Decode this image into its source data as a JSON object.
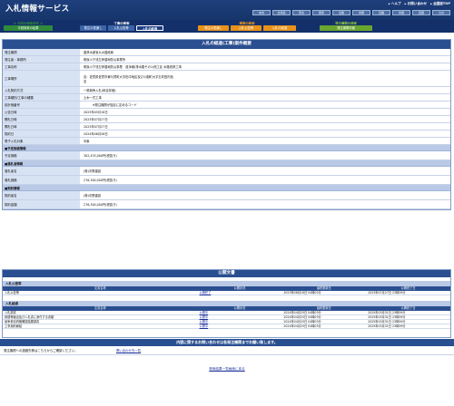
{
  "app": {
    "title": "入札情報サービス",
    "top_links": [
      "ヘルプ",
      "お問い合わせ",
      "全国版TOP"
    ],
    "regions": [
      "本省",
      "北海道",
      "東北",
      "関東",
      "北陸",
      "中部",
      "近畿",
      "中国",
      "四国",
      "九州"
    ]
  },
  "nav": {
    "groups": [
      {
        "title": "＊ 今回の検索条件 ＊",
        "color": "#2f8a3a",
        "tabs": [
          {
            "label": "今回検索の結果",
            "bg": "#2f8a3a"
          }
        ]
      },
      {
        "title": "工事の検索",
        "color": "#ffffff",
        "tabs": [
          {
            "label": "発注の見通し",
            "bg": "#3d64a8"
          },
          {
            "label": "入札公告等",
            "bg": "#3d64a8"
          },
          {
            "label": "入札の経過",
            "bg": "#1b3e84",
            "active": true
          }
        ]
      },
      {
        "title": "業務の検索",
        "color": "#f39a1c",
        "tabs": [
          {
            "label": "発注の見通し",
            "bg": "#e8921a"
          },
          {
            "label": "入札公告等",
            "bg": "#e8921a"
          },
          {
            "label": "入札の経過",
            "bg": "#e8921a"
          }
        ]
      },
      {
        "title": "発注機関の検索",
        "color": "#8dc63f",
        "tabs": [
          {
            "label": "発注機関情報",
            "bg": "#6aa52e"
          }
        ]
      }
    ]
  },
  "summary": {
    "heading": "入札の経過(工事)案件概要",
    "rows": [
      {
        "label": "発注機関",
        "value": "農林水産省九州農政局"
      },
      {
        "label": "発注者・事務所",
        "value": "筑後川下流左岸農地防災事業所"
      },
      {
        "label": "工事名称",
        "value": "筑後川下流左岸農地防災事業　道永線(排水路その1)他工区 水路改修工事"
      },
      {
        "label": "工事場所",
        "value": "自：佐賀県佐賀市東与賀町大字田中地区及び川副町大字五町田内色\n至",
        "tall": true
      },
      {
        "label": "入札契約方式",
        "value": "一般競争入札(総合評価)"
      },
      {
        "label": "工事種別/工事の種類",
        "value": "土木一式工事"
      },
      {
        "label": "該計価番号",
        "value": "　　　※発注機関が独自に定めるコード"
      },
      {
        "label": "公告日時",
        "value": "2023年05月18日"
      },
      {
        "label": "開札日時",
        "value": "2023年07月27日"
      },
      {
        "label": "開札日時",
        "value": "2023年07月27日"
      },
      {
        "label": "契約日",
        "value": "2024年06月26日"
      },
      {
        "label": "電子入札対象",
        "value": "対象"
      }
    ],
    "price_head": "■予定価格情報",
    "price_rows": [
      {
        "label": "予定価格",
        "value": "302,433,000円(税抜き)"
      }
    ],
    "winner_head": "■落札者情報",
    "winner_rows": [
      {
        "label": "落札者名",
        "value": "(株)中野建設"
      },
      {
        "label": "落札価格",
        "value": "276,300,000円(税抜き)"
      }
    ],
    "contract_head": "■契約情報",
    "contract_rows": [
      {
        "label": "契約者名",
        "value": "(株)中野建設"
      },
      {
        "label": "契約金額",
        "value": "276,300,000円(税抜き)"
      }
    ]
  },
  "documents": {
    "heading": "公開文書",
    "columns": [
      "文書名称",
      "公開状況",
      "最終更新日",
      "公開終了日"
    ],
    "announce_title": "入札公告等",
    "announce_rows": [
      {
        "name": "入札公告等",
        "status": "公開終了",
        "updated": "2023年06月16日 04時02分",
        "end": "2023年07月27日 23時59分"
      }
    ],
    "process_title": "入札経過",
    "process_rows": [
      {
        "name": "入札調書",
        "status": "公開中",
        "updated": "2024年04月25日 04時03分",
        "end": "2025年03月31日 23時59分"
      },
      {
        "name": "辞退等届出及び入札書に添付する書類",
        "status": "公開中",
        "updated": "2024年04月25日 04時03分",
        "end": "2025年03月31日 23時59分"
      },
      {
        "name": "競争参加資格確認結果調書",
        "status": "公開中",
        "updated": "2024年04月25日 04時03分",
        "end": "2025年03月31日 23時59分"
      },
      {
        "name": "工事契約締結",
        "status": "公開中",
        "updated": "2024年04月25日 04時03分",
        "end": "2025年03月31日 23時59分"
      }
    ]
  },
  "inquiry": {
    "bar": "内容に関するお問い合わせは各発注機関までお願い致します。",
    "label": "発注機関への連絡先等はこちらからご確認ください。",
    "link": "問い合わせ先一覧"
  },
  "footer": {
    "back_link": "検索結果一覧画面に戻る"
  }
}
